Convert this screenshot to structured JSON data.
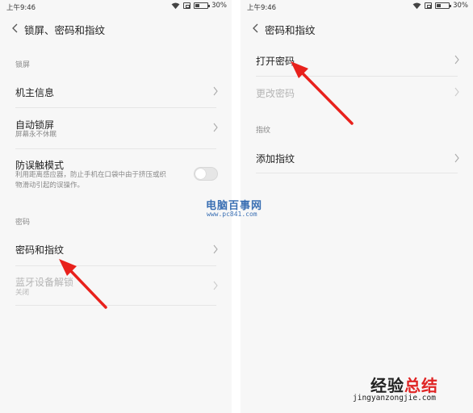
{
  "left_screen": {
    "status": {
      "time": "上午9:46",
      "battery": "30%",
      "battery_level": 0.3
    },
    "title": "锁屏、密码和指纹",
    "section_lock": "锁屏",
    "items": [
      {
        "label": "机主信息"
      },
      {
        "label": "自动锁屏",
        "sub": "屏幕永不休眠"
      },
      {
        "label": "防误触模式",
        "sub1": "利用距离感应器，防止手机在口袋中由于挤压或织",
        "sub2": "物滑动引起的误操作。",
        "toggle_on": false
      },
      {
        "label": "密码和指纹"
      },
      {
        "label": "蓝牙设备解锁",
        "sub": "关闭",
        "disabled": true
      }
    ],
    "section_password": "密码"
  },
  "right_screen": {
    "status": {
      "time": "上午9:46",
      "battery": "30%",
      "battery_level": 0.3
    },
    "title": "密码和指纹",
    "items": [
      {
        "label": "打开密码"
      },
      {
        "label": "更改密码",
        "disabled": true
      },
      {
        "label": "添加指纹"
      }
    ],
    "section_fingerprint": "指纹"
  },
  "watermarks": {
    "site_cn": "电脑百事网",
    "site_url": "www.pc841.com",
    "brand_a": "经验",
    "brand_b": "总结",
    "brand_url": "jingyanzongjie.com"
  },
  "colors": {
    "arrow": "#e8211c",
    "watermark_blue": "#3a6fb3",
    "brand_red": "#e02424"
  }
}
